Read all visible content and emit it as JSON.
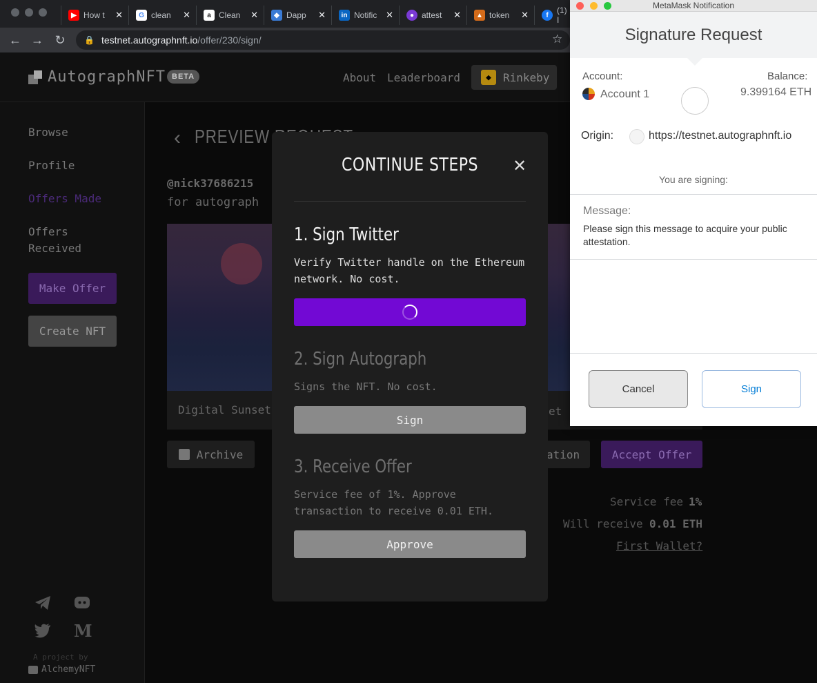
{
  "browser": {
    "tabs": [
      {
        "label": "How t",
        "fav": "▶",
        "color": "#ff0000"
      },
      {
        "label": "clean",
        "fav": "G",
        "color": "#ffffff"
      },
      {
        "label": "Clean",
        "fav": "a",
        "color": "#222222"
      },
      {
        "label": "Dapp",
        "fav": "◆",
        "color": "#3a7bd5"
      },
      {
        "label": "Notific",
        "fav": "in",
        "color": "#0a66c2"
      },
      {
        "label": "attest",
        "fav": "●",
        "color": "#7a3ad5"
      },
      {
        "label": "token",
        "fav": "▲",
        "color": "#d46b1a"
      },
      {
        "label": "(1) I",
        "fav": "f",
        "color": "#1877f2"
      }
    ],
    "url_host": "testnet.autographnft.io",
    "url_path": "/offer/230/sign/"
  },
  "site": {
    "logo": "AutographNFT",
    "beta": "BETA",
    "nav": {
      "about": "About",
      "leaderboard": "Leaderboard"
    },
    "network": "Rinkeby"
  },
  "sidebar": {
    "browse": "Browse",
    "profile": "Profile",
    "offers_made": "Offers Made",
    "offers_received_1": "Offers",
    "offers_received_2": "Received",
    "make_offer": "Make Offer",
    "create_nft": "Create NFT",
    "credit_line": "A project by",
    "credit_org": "AlchemyNFT"
  },
  "main": {
    "title": "PREVIEW REQUEST",
    "handle": "@nick37686215",
    "for_text": "for autograph",
    "caption_left": "Digital Sunset",
    "caption_right": "et",
    "archive": "Archive",
    "partial_btn": "ation",
    "accept": "Accept Offer",
    "service_fee_label": "Service fee",
    "service_fee_value": "1%",
    "receive_label": "Will receive",
    "receive_value": "0.01 ETH",
    "first_wallet": "First Wallet?"
  },
  "modal": {
    "title": "CONTINUE STEPS",
    "steps": [
      {
        "title": "1. Sign Twitter",
        "desc": "Verify Twitter handle on the Ethereum network. No cost."
      },
      {
        "title": "2. Sign Autograph",
        "desc": "Signs the NFT. No cost.",
        "button": "Sign"
      },
      {
        "title": "3. Receive Offer",
        "desc": "Service fee of 1%. Approve transaction to receive 0.01 ETH.",
        "button": "Approve"
      }
    ]
  },
  "metamask": {
    "window_title": "MetaMask Notification",
    "title": "Signature Request",
    "account_label": "Account:",
    "account_name": "Account 1",
    "balance_label": "Balance:",
    "balance_value": "9.399164 ETH",
    "origin_label": "Origin:",
    "origin_value": "https://testnet.autographnft.io",
    "signing_label": "You are signing:",
    "message_label": "Message:",
    "message_text": "Please sign this message to acquire your public attestation.",
    "cancel": "Cancel",
    "sign": "Sign"
  },
  "colors": {
    "accent_purple": "#7209d4",
    "metamask_blue": "#037dd6"
  }
}
